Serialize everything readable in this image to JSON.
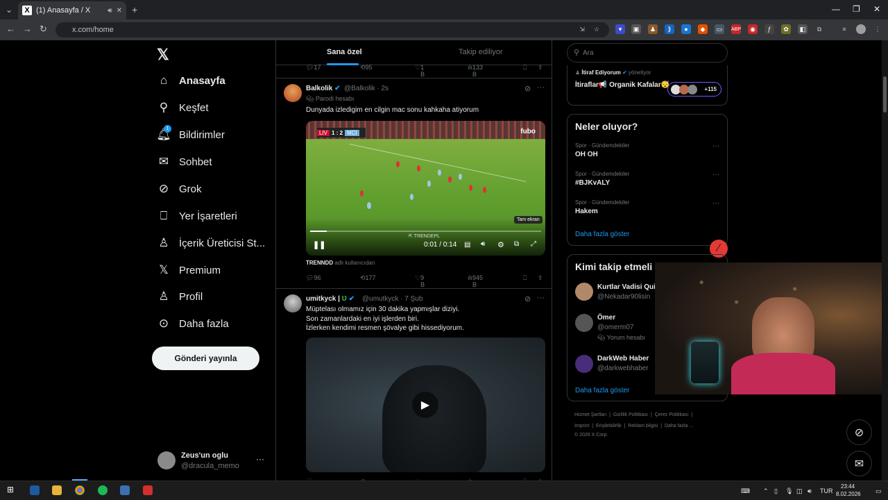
{
  "browser": {
    "tab_title": "(1) Anasayfa / X",
    "url": "x.com/home"
  },
  "nav": {
    "items": [
      {
        "label": "Anasayfa",
        "icon": "home-icon",
        "bold": true
      },
      {
        "label": "Keşfet",
        "icon": "search-icon"
      },
      {
        "label": "Bildirimler",
        "icon": "bell-icon",
        "badge": "1"
      },
      {
        "label": "Sohbet",
        "icon": "mail-icon"
      },
      {
        "label": "Grok",
        "icon": "grok-icon"
      },
      {
        "label": "Yer İşaretleri",
        "icon": "bookmark-icon"
      },
      {
        "label": "İçerik Üreticisi St...",
        "icon": "creator-icon"
      },
      {
        "label": "Premium",
        "icon": "x-icon"
      },
      {
        "label": "Profil",
        "icon": "person-icon"
      },
      {
        "label": "Daha fazla",
        "icon": "more-circle-icon"
      }
    ],
    "post_button": "Gönderi yayınla",
    "account": {
      "name": "Zeus'un oglu",
      "handle": "@dracula_memo"
    }
  },
  "feed": {
    "tabs": {
      "for_you": "Sana özel",
      "following": "Takip ediliyor"
    },
    "prev_actions": {
      "replies": "17",
      "reposts": "95",
      "likes": "1 B",
      "views": "133 B"
    },
    "tweet1": {
      "name": "Balkolik",
      "handle": "@Balkolik",
      "time": "· 2s",
      "parody": "Parodi hesabı",
      "text": "Dunyada izledigim en cilgin mac sonu kahkaha atiyorum",
      "video": {
        "score_home": "LIV",
        "score": "1 : 2",
        "score_away": "MCI",
        "broadcaster": "fubo",
        "watermark": "⇱ TRENDEPL",
        "time": "0:01 / 0:14",
        "tooltip": "Tam ekran"
      },
      "credit_user": "TRENNDD",
      "credit_label": "adlı kullanıcıdan",
      "actions": {
        "replies": "96",
        "reposts": "177",
        "likes": "9 B",
        "views": "945 B"
      }
    },
    "tweet2": {
      "name": "umitkyck |",
      "handle": "@umutkyck",
      "time": "· 7 Şub",
      "lines": [
        "Müptelası olmamız için 30 dakika yapmışlar diziyi.",
        "Son zamanlardaki en iyi işlerden biri.",
        "İzlerken kendimi resmen şövalye gibi hissediyorum."
      ]
    }
  },
  "right": {
    "search_placeholder": "Ara",
    "promo": {
      "label": "İtiraf Ediyorum",
      "sub": "yönetiyor",
      "title": "İtiraflar📢 Organik Kafalar😴",
      "members": "+115"
    },
    "trends_title": "Neler oluyor?",
    "trends": [
      {
        "category": "Spor · Gündemdekiler",
        "name": "OH OH"
      },
      {
        "category": "Spor · Gündemdekiler",
        "name": "#BJKvALY"
      },
      {
        "category": "Spor · Gündemdekiler",
        "name": "Hakem"
      }
    ],
    "trends_more": "Daha fazla göster",
    "follow_title": "Kimi takip etmeli",
    "follow": [
      {
        "name": "Kurtlar Vadisi Qui",
        "handle": "@Nekadar90lisin"
      },
      {
        "name": "Ömer",
        "handle": "@omerm07",
        "note": "Yorum hesabı"
      },
      {
        "name": "DarkWeb Haber",
        "handle": "@darkwebhaber"
      }
    ],
    "follow_more": "Daha fazla göster",
    "footer": {
      "row1": [
        "Hizmet Şartları",
        "Gizlilik Politikası",
        "Çerez Politikası"
      ],
      "row2": [
        "Imprint",
        "Erişilebilirlik",
        "Reklam bilgisi",
        "Daha fazla ..."
      ],
      "copyright": "© 2026 X Corp."
    }
  },
  "taskbar": {
    "lang": "TUR",
    "time": "23:44",
    "date": "8.02.2026"
  }
}
